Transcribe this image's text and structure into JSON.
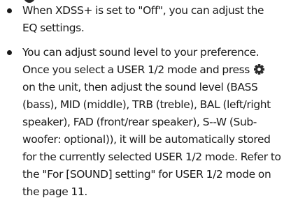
{
  "bullets": [
    {
      "text": "When XDSS+ is set to \"Off\", you can adjust the EQ settings."
    },
    {
      "text_before_icon": "You can adjust sound level to your preference. Once you select a USER 1/2 mode and press",
      "icon": "gear-icon",
      "text_after_icon": "on the unit, then adjust the sound level (BASS (bass), MID (middle), TRB (treble), BAL (left/right speaker), FAD (front/rear speaker), S--W (Sub-woofer: optional)), it will be automatically stored for the currently selected USER 1/2 mode. Refer to the \"For [SOUND] setting\" for USER 1/2 mode on the page 11."
    }
  ],
  "colors": {
    "text": "#1a1a1a",
    "icon": "#2b2b2b"
  }
}
